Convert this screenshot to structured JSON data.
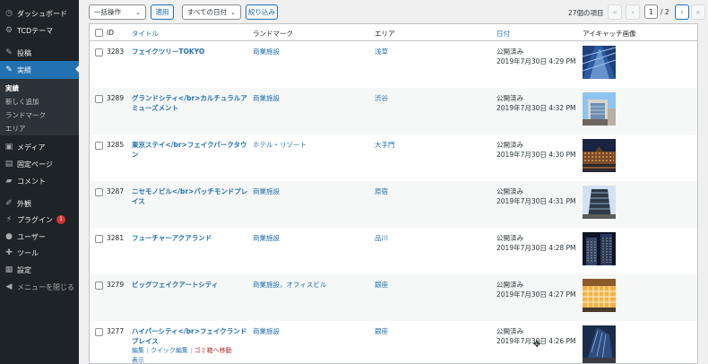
{
  "sidebar": {
    "items": [
      {
        "label": "ダッシュボード",
        "icon": "dashboard-icon",
        "glyph": "◷"
      },
      {
        "label": "TCDテーマ",
        "icon": "settings-icon",
        "glyph": "⚙"
      },
      {
        "label": "投稿",
        "icon": "pin-icon",
        "glyph": "✎"
      },
      {
        "label": "実績",
        "icon": "pin-icon",
        "glyph": "✎"
      },
      {
        "label": "メディア",
        "icon": "media-icon",
        "glyph": "▣"
      },
      {
        "label": "固定ページ",
        "icon": "page-icon",
        "glyph": "▤"
      },
      {
        "label": "コメント",
        "icon": "comment-icon",
        "glyph": "▰"
      },
      {
        "label": "外観",
        "icon": "brush-icon",
        "glyph": "✐"
      },
      {
        "label": "プラグイン",
        "icon": "plugin-icon",
        "glyph": "⚡"
      },
      {
        "label": "ユーザー",
        "icon": "user-icon",
        "glyph": "●"
      },
      {
        "label": "ツール",
        "icon": "wrench-icon",
        "glyph": "✚"
      },
      {
        "label": "設定",
        "icon": "settings-icon",
        "glyph": "▦"
      },
      {
        "label": "メニューを閉じる",
        "icon": "collapse-icon",
        "glyph": "◀"
      }
    ],
    "plugin_badge": "1",
    "submenu": [
      "実績",
      "新しく追加",
      "ランドマーク",
      "エリア"
    ]
  },
  "toolbar": {
    "bulk_action": "一括操作",
    "apply": "適用",
    "date_filter": "すべての日付",
    "filter": "絞り込み"
  },
  "pagination": {
    "count": "27個の項目",
    "first": "«",
    "prev": "‹",
    "current": "1",
    "total": "/ 2",
    "next": "›",
    "last": "»"
  },
  "table": {
    "headers": {
      "id": "ID",
      "title": "タイトル",
      "landmark": "ランドマーク",
      "area": "エリア",
      "date": "日付",
      "thumb": "アイキャッチ画像"
    },
    "row_actions": {
      "edit": "編集",
      "quick_edit": "クイック編集",
      "trash": "ゴミ箱へ移動",
      "view": "表示",
      "sep": "|"
    },
    "rows": [
      {
        "id": "3283",
        "title": "フェイクツリーTOKYO",
        "landmark": "商業施設",
        "area": "浅草",
        "status": "公開済み",
        "date": "2019年7月30日 4:29 PM"
      },
      {
        "id": "3289",
        "title": "グランドシティ</br>カルチュラルアミューズメント",
        "landmark": "商業施設",
        "area": "渋谷",
        "status": "公開済み",
        "date": "2019年7月30日 4:32 PM"
      },
      {
        "id": "3285",
        "title": "東京ステイ</br>フェイクパークタウン",
        "landmark": "ホテル・リゾート",
        "area": "大手門",
        "status": "公開済み",
        "date": "2019年7月30日 4:30 PM"
      },
      {
        "id": "3287",
        "title": "ニセモノビル</br>パッチモンドプレイス",
        "landmark": "商業施設",
        "area": "原宿",
        "status": "公開済み",
        "date": "2019年7月30日 4:31 PM"
      },
      {
        "id": "3281",
        "title": "フューチャーアクアランド",
        "landmark": "商業施設",
        "area": "品川",
        "status": "公開済み",
        "date": "2019年7月30日 4:28 PM"
      },
      {
        "id": "3279",
        "title": "ビッグフェイクアートシティ",
        "landmark": "商業施設，オフィスビル",
        "area": "銀座",
        "status": "公開済み",
        "date": "2019年7月30日 4:27 PM"
      },
      {
        "id": "3277",
        "title": "ハイパーシティ</br>フェイクランドプレイス",
        "landmark": "商業施設",
        "area": "銀座",
        "status": "公開済み",
        "date": "2019年7月30日 4:26 PM"
      }
    ]
  },
  "colors": {
    "accent": "#2271b1",
    "sidebar_bg": "#1d2327",
    "trash": "#b32d2e"
  }
}
